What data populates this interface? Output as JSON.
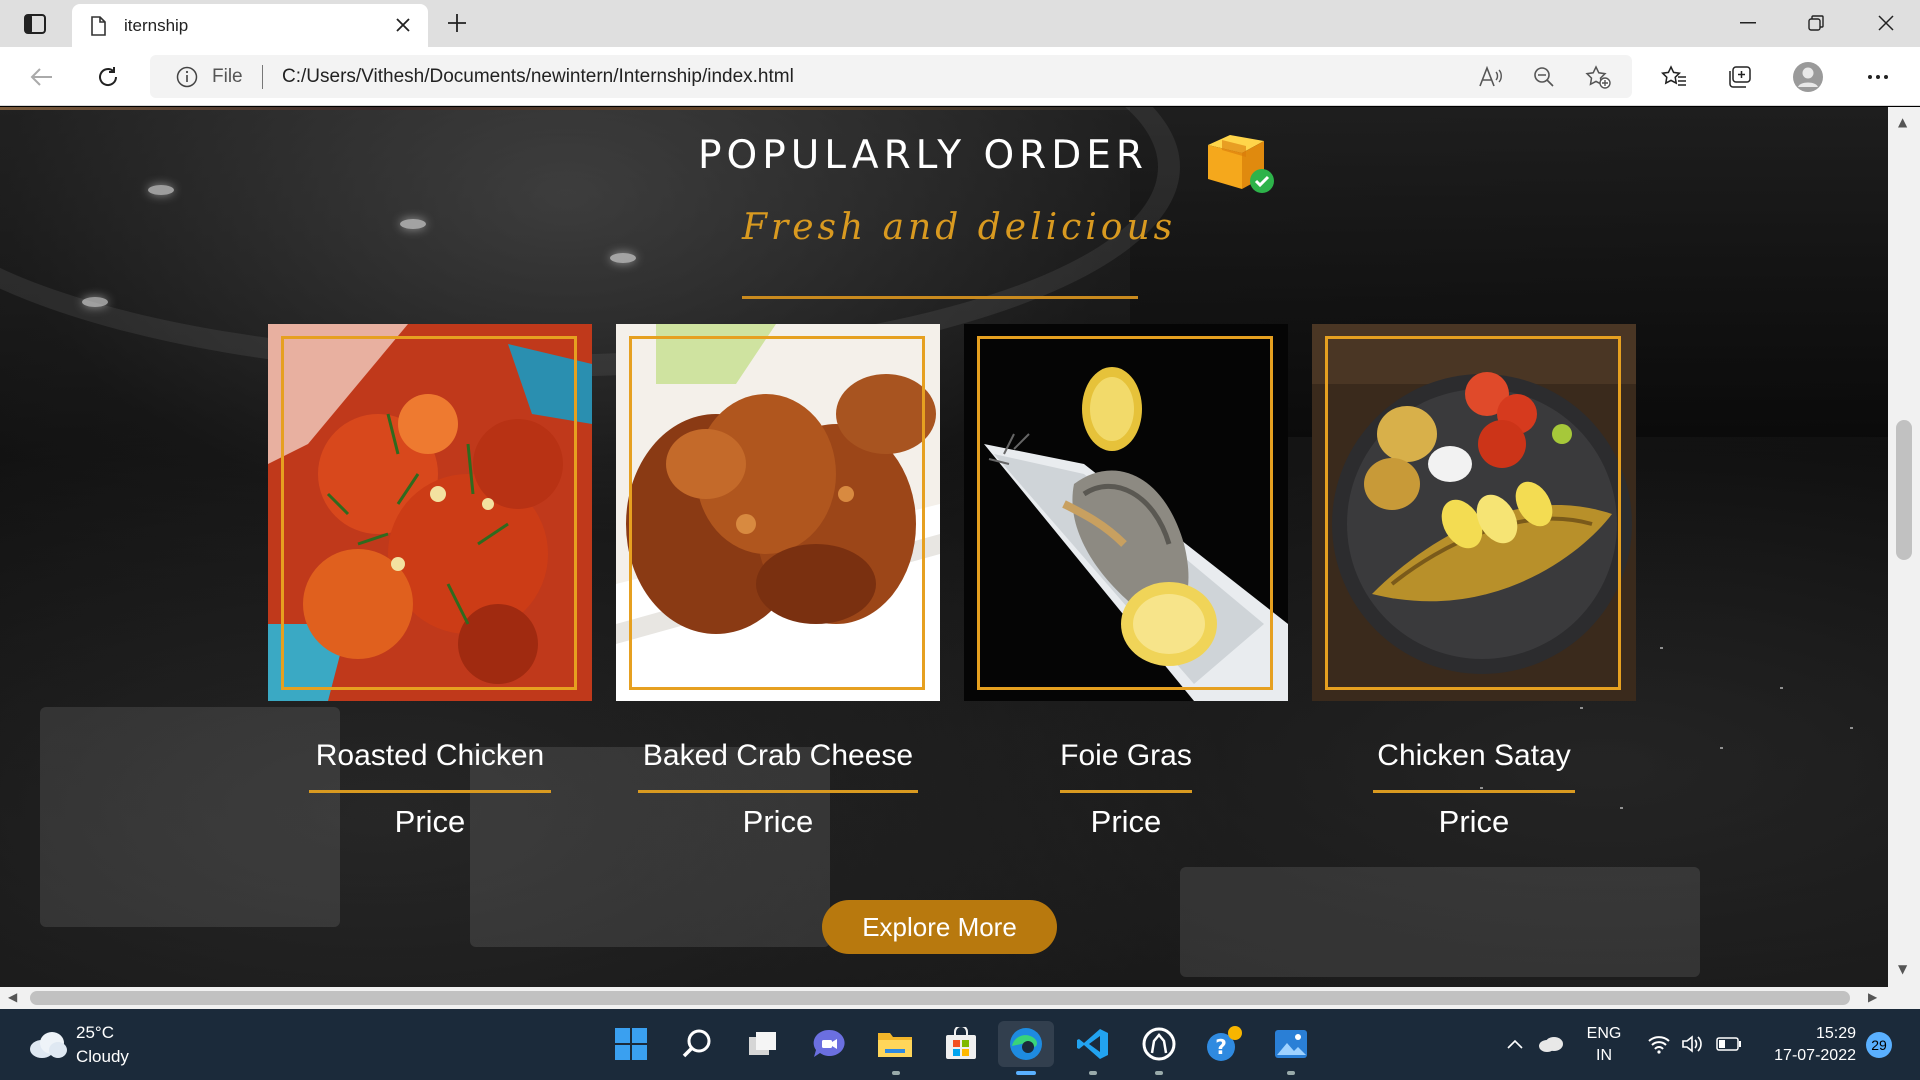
{
  "browser": {
    "tab_title": "iternship",
    "address_prefix": "File",
    "url": "C:/Users/Vithesh/Documents/newintern/Internship/index.html"
  },
  "page": {
    "heading": "POPULARLY ORDER",
    "subheading": "Fresh and delicious",
    "items": [
      {
        "name": "Roasted Chicken",
        "price": "Price"
      },
      {
        "name": "Baked Crab Cheese",
        "price": "Price"
      },
      {
        "name": "Foie Gras",
        "price": "Price"
      },
      {
        "name": "Chicken Satay",
        "price": "Price"
      }
    ],
    "explore_label": "Explore More",
    "accent_color": "#d99a20"
  },
  "taskbar": {
    "weather_temp": "25°C",
    "weather_desc": "Cloudy",
    "lang_top": "ENG",
    "lang_bottom": "IN",
    "time": "15:29",
    "date": "17-07-2022",
    "notifications": "29"
  }
}
